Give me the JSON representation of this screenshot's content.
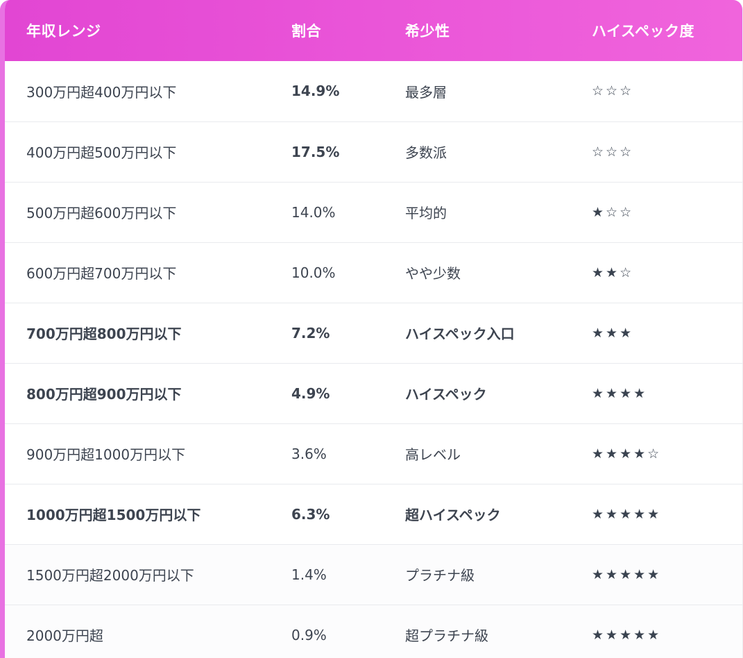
{
  "table": {
    "headers": [
      "年収レンジ",
      "割合",
      "希少性",
      "ハイスペック度"
    ],
    "rows": [
      {
        "range": "300万円超400万円以下",
        "ratio": "14.9%",
        "rarity": "最多層",
        "stars": "☆☆☆",
        "row_bold": false,
        "ratio_bold": true
      },
      {
        "range": "400万円超500万円以下",
        "ratio": "17.5%",
        "rarity": "多数派",
        "stars": "☆☆☆",
        "row_bold": false,
        "ratio_bold": true
      },
      {
        "range": "500万円超600万円以下",
        "ratio": "14.0%",
        "rarity": "平均的",
        "stars": "★☆☆",
        "row_bold": false,
        "ratio_bold": false
      },
      {
        "range": "600万円超700万円以下",
        "ratio": "10.0%",
        "rarity": "やや少数",
        "stars": "★★☆",
        "row_bold": false,
        "ratio_bold": false
      },
      {
        "range": "700万円超800万円以下",
        "ratio": "7.2%",
        "rarity": "ハイスペック入口",
        "stars": "★★★",
        "row_bold": true,
        "ratio_bold": true
      },
      {
        "range": "800万円超900万円以下",
        "ratio": "4.9%",
        "rarity": "ハイスペック",
        "stars": "★★★★",
        "row_bold": true,
        "ratio_bold": true
      },
      {
        "range": "900万円超1000万円以下",
        "ratio": "3.6%",
        "rarity": "高レベル",
        "stars": "★★★★☆",
        "row_bold": false,
        "ratio_bold": false
      },
      {
        "range": "1000万円超1500万円以下",
        "ratio": "6.3%",
        "rarity": "超ハイスペック",
        "stars": "★★★★★",
        "row_bold": true,
        "ratio_bold": true
      },
      {
        "range": "1500万円超2000万円以下",
        "ratio": "1.4%",
        "rarity": "プラチナ級",
        "stars": "★★★★★",
        "row_bold": false,
        "ratio_bold": false
      },
      {
        "range": "2000万円超",
        "ratio": "0.9%",
        "rarity": "超プラチナ級",
        "stars": "★★★★★",
        "row_bold": false,
        "ratio_bold": false
      }
    ]
  },
  "colors": {
    "header_gradient_start": "#e246d3",
    "header_gradient_end": "#f064dc",
    "accent_border": "#e872e2",
    "text": "#3d4450"
  }
}
